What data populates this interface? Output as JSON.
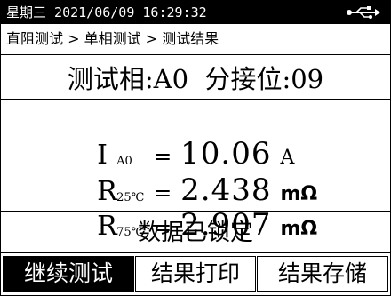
{
  "status_bar": {
    "weekday": "星期三",
    "datetime": "2021/06/09 16:29:32",
    "usb_icon": "usb-icon"
  },
  "breadcrumb": {
    "text": "直阻测试 > 单相测试 > 测试结果"
  },
  "phase": {
    "text": "测试相:A0  分接位:09"
  },
  "measurements": {
    "current": {
      "symbol": "I",
      "sub": "A0",
      "eq": "=",
      "value": "10.06",
      "unit": "A"
    },
    "r25": {
      "symbol": "R",
      "sub": "25℃",
      "eq": "=",
      "value": "2.438",
      "unit": "mΩ"
    },
    "r75": {
      "symbol": "R",
      "sub": "75℃",
      "eq": "=",
      "value": "2.907",
      "unit": "mΩ"
    }
  },
  "lock_message": "数据已锁定",
  "buttons": {
    "continue": "继续测试",
    "print": "结果打印",
    "save": "结果存储"
  },
  "colors": {
    "background": "#ffffff",
    "foreground": "#000000",
    "selected_bg": "#000000",
    "selected_fg": "#ffffff"
  }
}
